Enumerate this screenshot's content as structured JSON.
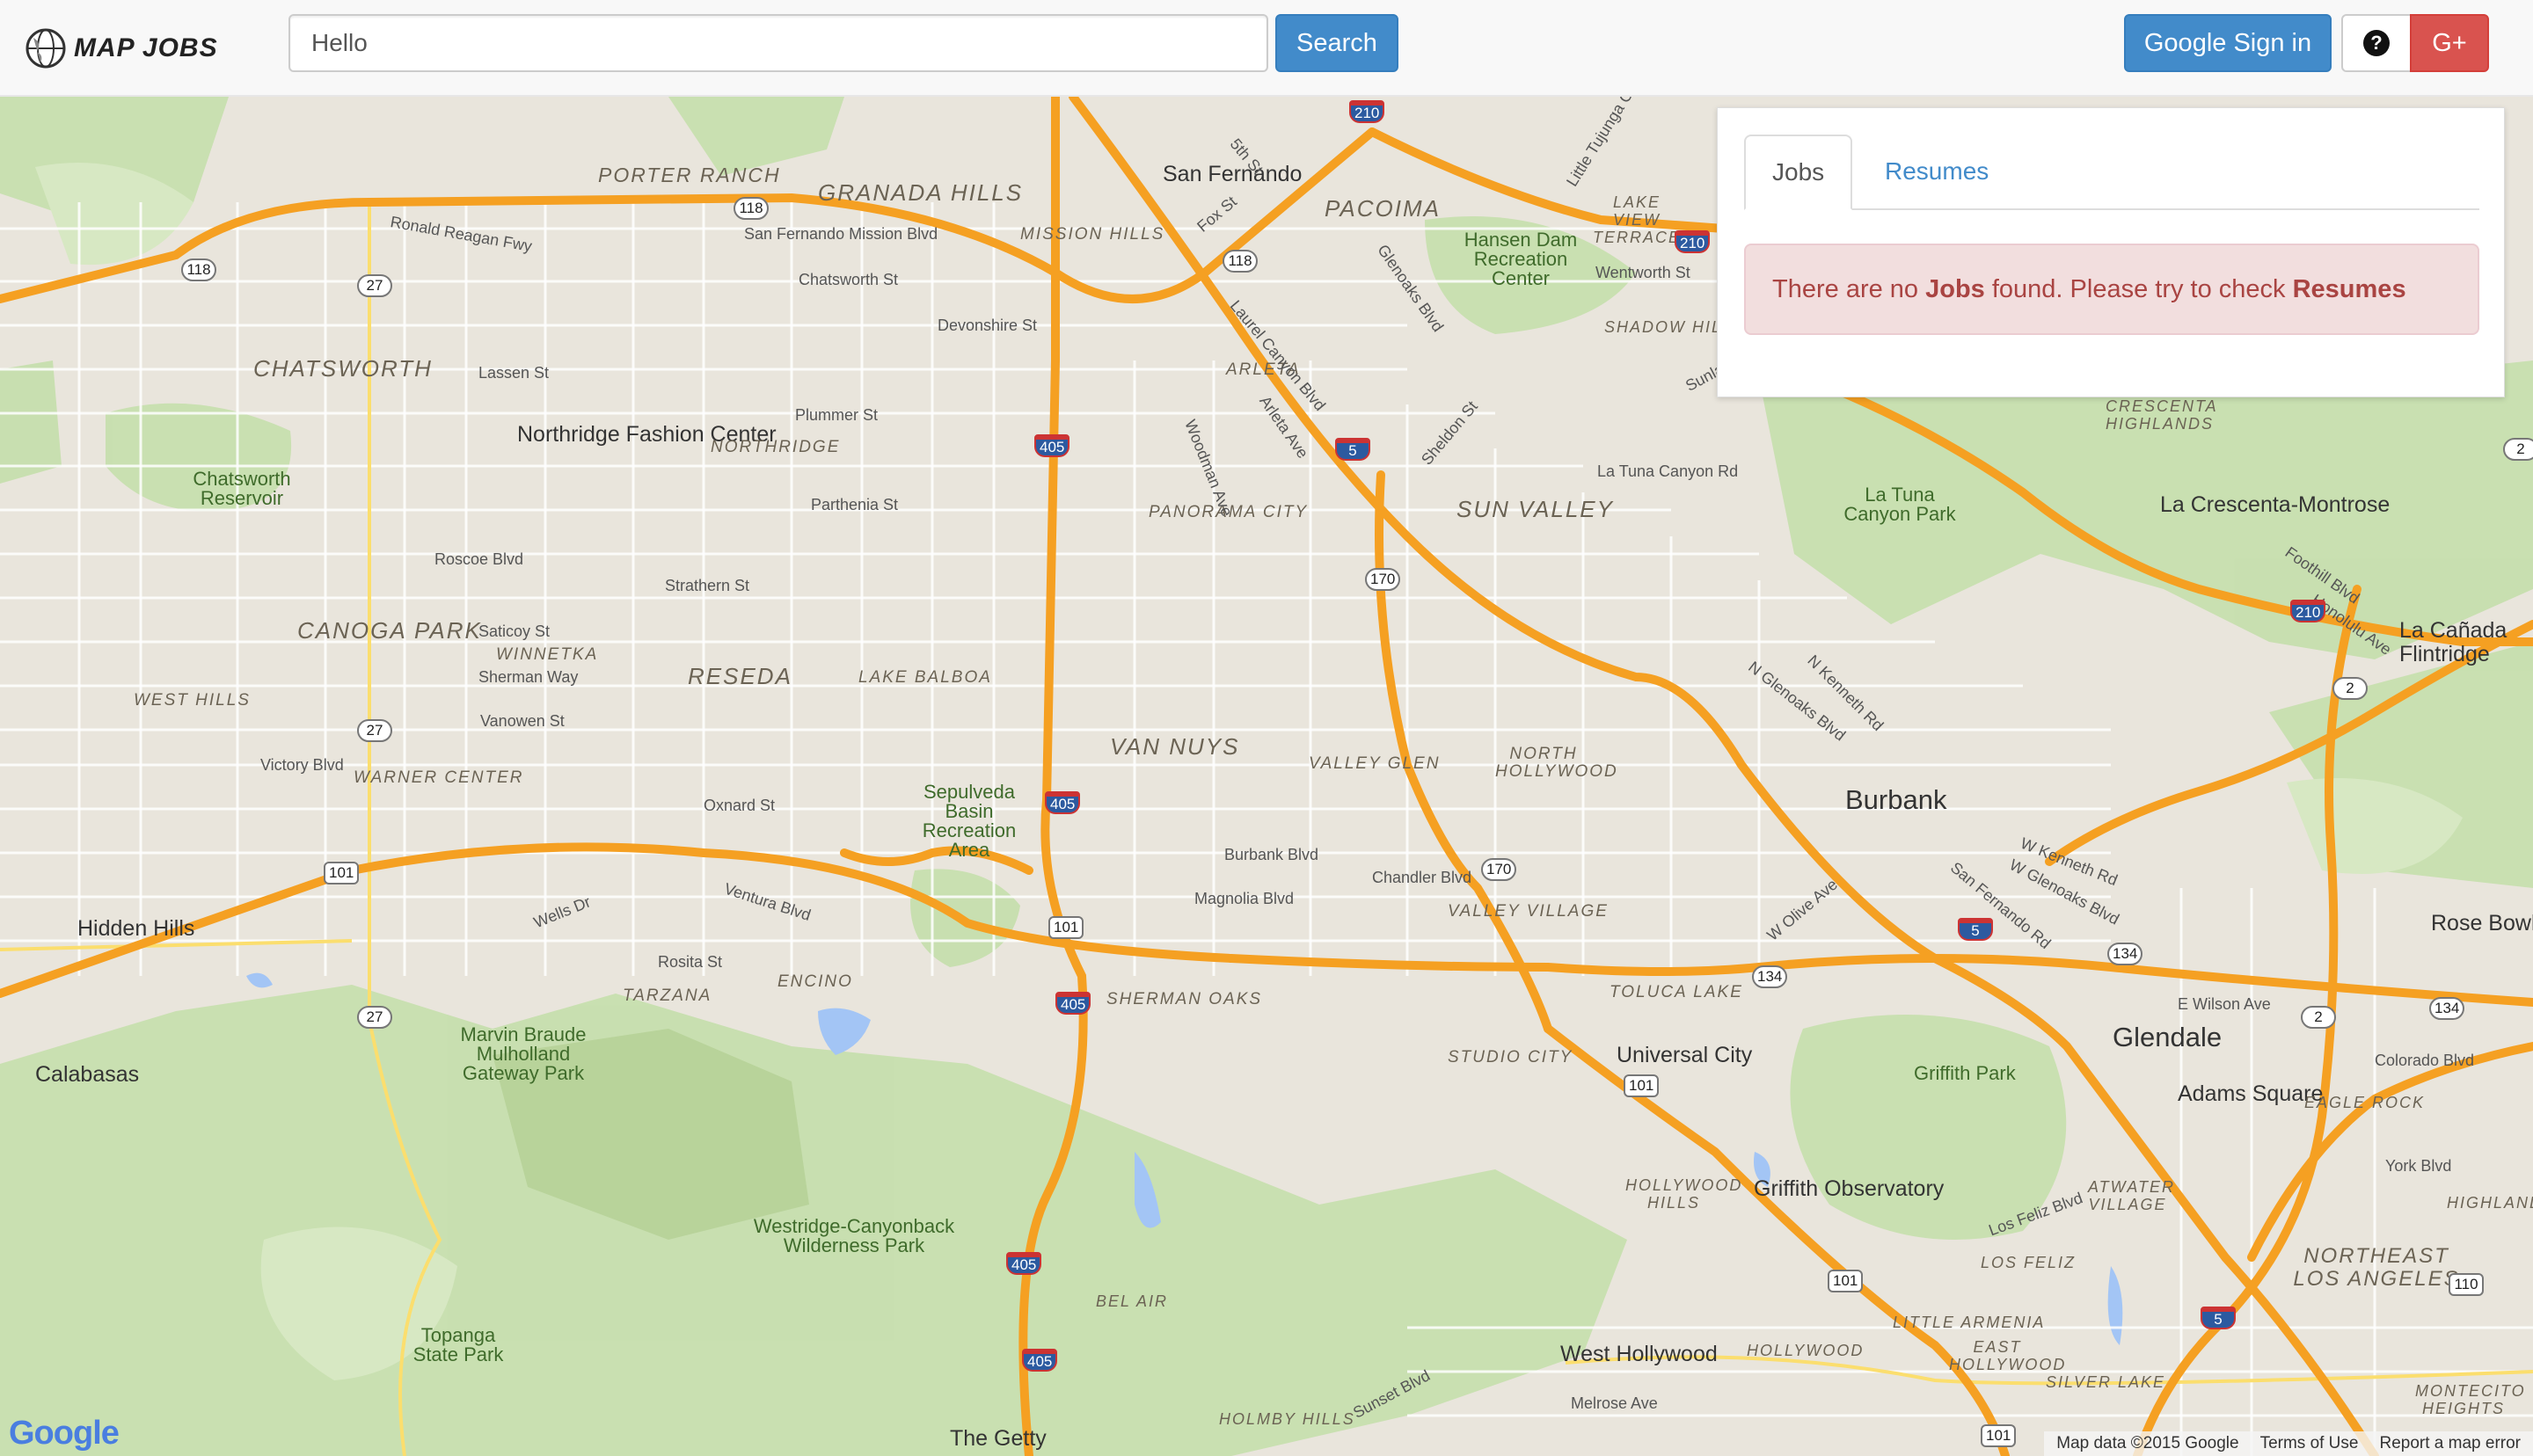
{
  "navbar": {
    "brand": "MAP JOBS",
    "brand_icon": "globe-icon",
    "search_value": "Hello",
    "search_button": "Search",
    "google_signin": "Google Sign in",
    "help_icon": "question-circle-icon",
    "help_glyph": "?",
    "gplus": "G+"
  },
  "panel": {
    "tabs": [
      {
        "label": "Jobs",
        "active": true
      },
      {
        "label": "Resumes",
        "active": false
      }
    ],
    "alert": {
      "prefix": "There are no ",
      "bold1": "Jobs",
      "middle": " found. Please try to check ",
      "bold2": "Resumes"
    }
  },
  "map": {
    "cities": [
      "San Fernando",
      "Northridge Fashion Center",
      "Universal City",
      "Burbank",
      "Glendale",
      "Adams Square",
      "Hidden Hills",
      "Calabasas",
      "West Hollywood",
      "Melrose Ave",
      "La Crescenta-Montrose",
      "La Cañada Flintridge",
      "Rose Bowl",
      "Griffith Observatory",
      "The Getty"
    ],
    "areas": [
      "PORTER RANCH",
      "GRANADA HILLS",
      "PACOIMA",
      "MISSION HILLS",
      "CHATSWORTH",
      "NORTHRIDGE",
      "ARLETA",
      "PANORAMA CITY",
      "SUN VALLEY",
      "CANOGA PARK",
      "WINNETKA",
      "RESEDA",
      "LAKE BALBOA",
      "VAN NUYS",
      "WEST HILLS",
      "WARNER CENTER",
      "VALLEY GLEN",
      "NORTH HOLLYWOOD",
      "VALLEY VILLAGE",
      "TOLUCA LAKE",
      "SHERMAN OAKS",
      "STUDIO CITY",
      "TARZANA",
      "ENCINO",
      "LAKE VIEW TERRACE",
      "SHADOW HILLS",
      "CRESCENTA HIGHLANDS",
      "EAGLE ROCK",
      "HIGHLAND PARK",
      "ATWATER VILLAGE",
      "NORTHEAST LOS ANGELES",
      "HOLLYWOOD HILLS",
      "LOS FELIZ",
      "LITTLE ARMENIA",
      "EAST HOLLYWOOD",
      "SILVER LAKE",
      "BEL AIR",
      "HOLMBY HILLS",
      "HOLLYWOOD",
      "MONTECITO HEIGHTS"
    ],
    "parks": [
      "Hansen Dam Recreation Center",
      "Chatsworth Reservoir",
      "Sepulveda Basin Recreation Area",
      "Marvin Braude Mulholland Gateway Park",
      "Westridge-Canyonback Wilderness Park",
      "Topanga State Park",
      "Griffith Park",
      "La Tuna Canyon Park"
    ],
    "streets": [
      "Ronald Reagan Fwy",
      "San Fernando Mission Blvd",
      "Chatsworth St",
      "Devonshire St",
      "Lassen St",
      "Plummer St",
      "Parthenia St",
      "Roscoe Blvd",
      "Strathern St",
      "Saticoy St",
      "Sherman Way",
      "Vanowen St",
      "Victory Blvd",
      "Oxnard St",
      "Burbank Blvd",
      "Magnolia Blvd",
      "Chandler Blvd",
      "Ventura Blvd",
      "Wells Dr",
      "Rosita St",
      "La Tuna Canyon Rd",
      "Foothill Blvd",
      "Honolulu Ave",
      "Wentworth St",
      "Sunland Blvd",
      "N Glenoaks Blvd",
      "N Kenneth Rd",
      "W Olive Ave",
      "San Fernando Rd",
      "W Glenoaks Blvd",
      "W Kenneth Rd",
      "E Wilson Ave",
      "Colorado Blvd",
      "York Blvd",
      "Los Feliz Blvd",
      "Sunset Blvd",
      "Fox St",
      "5th St",
      "Laurel Canyon Blvd",
      "Arleta Ave",
      "Woodman Ave",
      "Sheldon St",
      "Glenoaks Blvd",
      "Little Tujunga C"
    ],
    "shields": [
      {
        "type": "interstate",
        "num": "210"
      },
      {
        "type": "state",
        "num": "118"
      },
      {
        "type": "state",
        "num": "27"
      },
      {
        "type": "interstate",
        "num": "405"
      },
      {
        "type": "interstate",
        "num": "5"
      },
      {
        "type": "state",
        "num": "170"
      },
      {
        "type": "us",
        "num": "101"
      },
      {
        "type": "state",
        "num": "134"
      },
      {
        "type": "state",
        "num": "2"
      },
      {
        "type": "state",
        "num": "110"
      }
    ],
    "google_logo": "Google",
    "attribution": [
      "Map data ©2015 Google",
      "Terms of Use",
      "Report a map error"
    ]
  }
}
